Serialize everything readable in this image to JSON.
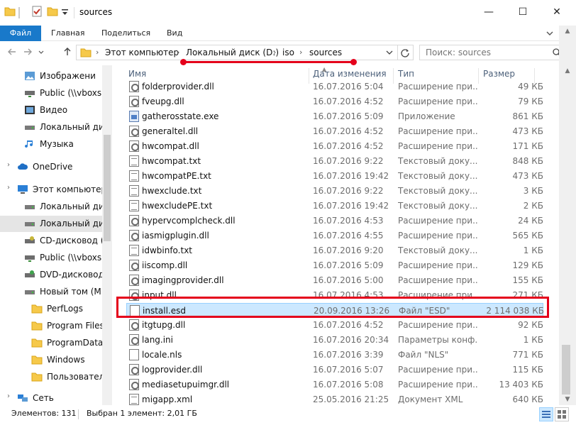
{
  "window": {
    "title": "sources",
    "controls": {
      "minimize": "—",
      "maximize": "☐",
      "close": "✕"
    }
  },
  "ribbon": {
    "file_tab": "Файл",
    "tabs": [
      "Главная",
      "Поделиться",
      "Вид"
    ],
    "expand_icon": "chevron-down-icon",
    "help_icon": "help-icon"
  },
  "address": {
    "crumbs": [
      "Этот компьютер",
      "Локальный диск (D:)",
      "iso",
      "sources"
    ],
    "separator": "›"
  },
  "search": {
    "placeholder": "Поиск: sources"
  },
  "nav": {
    "items": [
      {
        "label": "Изображени",
        "icon": "pictures-icon"
      },
      {
        "label": "Public (\\\\vboxsrv",
        "icon": "network-drive-icon"
      },
      {
        "label": "Видео",
        "icon": "video-icon"
      },
      {
        "label": "Локальный дис",
        "icon": "drive-icon"
      },
      {
        "label": "Музыка",
        "icon": "music-icon"
      },
      {
        "label": "OneDrive",
        "icon": "cloud-icon"
      },
      {
        "label": "Этот компьютер",
        "icon": "computer-icon"
      },
      {
        "label": "Локальный дис",
        "icon": "drive-icon"
      },
      {
        "label": "Локальный дис",
        "icon": "drive-icon",
        "selected": true
      },
      {
        "label": "CD-дисковод (E",
        "icon": "cd-drive-icon"
      },
      {
        "label": "Public (\\\\vboxsrv",
        "icon": "network-drive-icon"
      },
      {
        "label": "DVD-дисковод (",
        "icon": "dvd-drive-icon"
      },
      {
        "label": "Новый том (M:)",
        "icon": "drive-icon"
      },
      {
        "label": "PerfLogs",
        "icon": "folder-icon"
      },
      {
        "label": "Program Files",
        "icon": "folder-icon"
      },
      {
        "label": "ProgramData",
        "icon": "folder-icon"
      },
      {
        "label": "Windows",
        "icon": "folder-icon"
      },
      {
        "label": "Пользователи",
        "icon": "folder-icon"
      },
      {
        "label": "Сеть",
        "icon": "network-icon"
      }
    ]
  },
  "columns": {
    "name": "Имя",
    "date": "Дата изменения",
    "type": "Тип",
    "size": "Размер"
  },
  "files": [
    {
      "name": "folderprovider.dll",
      "date": "16.07.2016 5:04",
      "type": "Расширение при...",
      "size": "49 КБ",
      "icon": "gear"
    },
    {
      "name": "fveupg.dll",
      "date": "16.07.2016 4:52",
      "type": "Расширение при...",
      "size": "79 КБ",
      "icon": "gear"
    },
    {
      "name": "gatherosstate.exe",
      "date": "16.07.2016 5:09",
      "type": "Приложение",
      "size": "861 КБ",
      "icon": "exe"
    },
    {
      "name": "generaltel.dll",
      "date": "16.07.2016 4:52",
      "type": "Расширение при...",
      "size": "473 КБ",
      "icon": "gear"
    },
    {
      "name": "hwcompat.dll",
      "date": "16.07.2016 4:52",
      "type": "Расширение при...",
      "size": "171 КБ",
      "icon": "gear"
    },
    {
      "name": "hwcompat.txt",
      "date": "16.07.2016 9:22",
      "type": "Текстовый доку...",
      "size": "848 КБ",
      "icon": "txt"
    },
    {
      "name": "hwcompatPE.txt",
      "date": "16.07.2016 19:42",
      "type": "Текстовый доку...",
      "size": "473 КБ",
      "icon": "txt"
    },
    {
      "name": "hwexclude.txt",
      "date": "16.07.2016 9:22",
      "type": "Текстовый доку...",
      "size": "3 КБ",
      "icon": "txt"
    },
    {
      "name": "hwexcludePE.txt",
      "date": "16.07.2016 19:42",
      "type": "Текстовый доку...",
      "size": "2 КБ",
      "icon": "txt"
    },
    {
      "name": "hypervcomplcheck.dll",
      "date": "16.07.2016 4:53",
      "type": "Расширение при...",
      "size": "24 КБ",
      "icon": "gear"
    },
    {
      "name": "iasmigplugin.dll",
      "date": "16.07.2016 4:55",
      "type": "Расширение при...",
      "size": "565 КБ",
      "icon": "gear"
    },
    {
      "name": "idwbinfo.txt",
      "date": "16.07.2016 9:20",
      "type": "Текстовый доку...",
      "size": "1 КБ",
      "icon": "txt"
    },
    {
      "name": "iiscomp.dll",
      "date": "16.07.2016 5:09",
      "type": "Расширение при...",
      "size": "129 КБ",
      "icon": "gear"
    },
    {
      "name": "imagingprovider.dll",
      "date": "16.07.2016 5:00",
      "type": "Расширение при...",
      "size": "155 КБ",
      "icon": "gear"
    },
    {
      "name": "input.dll",
      "date": "16.07.2016 4:53",
      "type": "Расширение при...",
      "size": "271 КБ",
      "icon": "gear"
    },
    {
      "name": "install.esd",
      "date": "20.09.2016 13:26",
      "type": "Файл \"ESD\"",
      "size": "2 114 038 КБ",
      "icon": "file",
      "selected": true
    },
    {
      "name": "itgtupg.dll",
      "date": "16.07.2016 4:52",
      "type": "Расширение при...",
      "size": "92 КБ",
      "icon": "gear"
    },
    {
      "name": "lang.ini",
      "date": "16.07.2016 20:34",
      "type": "Параметры конф...",
      "size": "1 КБ",
      "icon": "gear"
    },
    {
      "name": "locale.nls",
      "date": "16.07.2016 3:39",
      "type": "Файл \"NLS\"",
      "size": "771 КБ",
      "icon": "file"
    },
    {
      "name": "logprovider.dll",
      "date": "16.07.2016 5:07",
      "type": "Расширение при...",
      "size": "115 КБ",
      "icon": "gear"
    },
    {
      "name": "mediasetupuimgr.dll",
      "date": "16.07.2016 5:08",
      "type": "Расширение при...",
      "size": "13 403 КБ",
      "icon": "gear"
    },
    {
      "name": "migapp.xml",
      "date": "25.05.2016 21:25",
      "type": "Документ XML",
      "size": "640 КБ",
      "icon": "txt"
    }
  ],
  "status": {
    "count": "Элементов: 131",
    "selection": "Выбран 1 элемент: 2,01 ГБ"
  },
  "colors": {
    "accent": "#1979ca",
    "selection": "#cce8ff",
    "highlight": "#e4001b"
  }
}
